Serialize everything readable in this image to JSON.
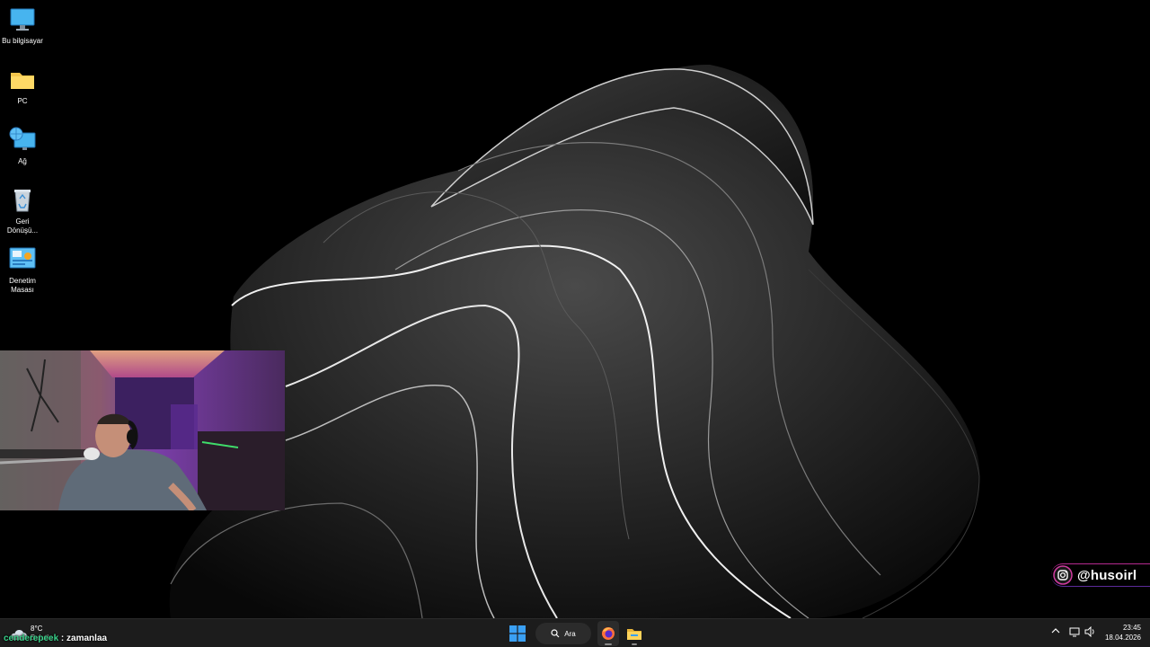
{
  "desktop": {
    "icons": [
      {
        "label": "Bu bilgisayar",
        "icon": "monitor-icon"
      },
      {
        "label": "PC",
        "icon": "folder-icon"
      },
      {
        "label": "Ağ",
        "icon": "network-icon"
      },
      {
        "label": "Geri Dönüşü...",
        "icon": "recycle-bin-icon"
      },
      {
        "label": "Denetim Masası",
        "icon": "control-panel-icon"
      }
    ]
  },
  "overlay": {
    "instagram_handle": "@husoirl",
    "chat_user": "cenderepeek",
    "chat_message": " : zamanlaa"
  },
  "taskbar": {
    "weather": {
      "temp": "8°C",
      "condition": "Bulutlu"
    },
    "search_label": "Ara",
    "clock": {
      "time": "23:45",
      "date": "18.04.2026"
    }
  },
  "colors": {
    "taskbar_bg": "#1c1c1c",
    "start_blue": "#3aa0f3",
    "chat_user": "#39d18a"
  }
}
